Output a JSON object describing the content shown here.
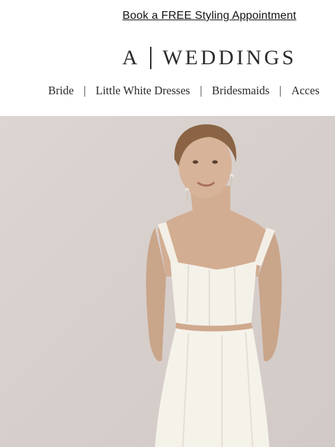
{
  "promo": {
    "label": "Book a FREE Styling Appointment"
  },
  "logo": {
    "left": "A",
    "right": "WEDDINGS"
  },
  "nav": {
    "items": [
      "Bride",
      "Little White Dresses",
      "Bridesmaids",
      "Acces"
    ],
    "separator": "|"
  },
  "hero": {
    "subject": "bride-in-white-corset-top-and-skirt"
  },
  "colors": {
    "hero_bg": "#d7cfcc",
    "text": "#2a2a2a"
  }
}
